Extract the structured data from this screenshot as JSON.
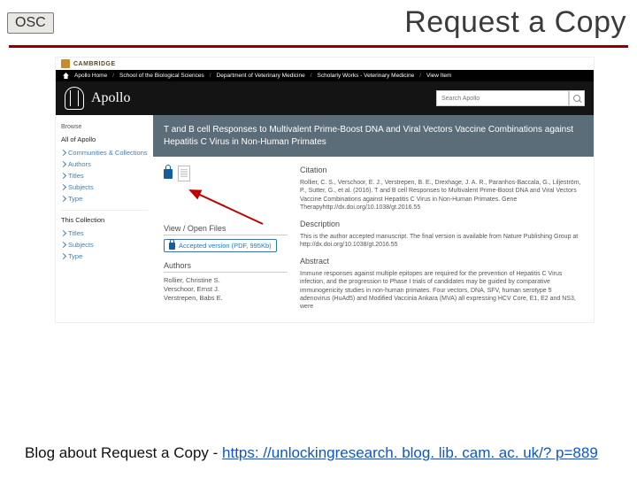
{
  "slide": {
    "badge": "OSC",
    "title": "Request a Copy",
    "caption_prefix": "Blog about Request a Copy - ",
    "caption_link": "https: //unlockingresearch. blog. lib. cam. ac. uk/? p=889"
  },
  "cambridge": {
    "name": "CAMBRIDGE"
  },
  "breadcrumbs": {
    "home": "Apollo Home",
    "b1": "School of the Biological Sciences",
    "b2": "Department of Veterinary Medicine",
    "b3": "Scholarly Works - Veterinary Medicine",
    "b4": "View Item"
  },
  "brand": "Apollo",
  "search": {
    "placeholder": "Search Apollo"
  },
  "sidebar": {
    "browse": "Browse",
    "all_heading": "All of Apollo",
    "items1": {
      "a": "Communities & Collections",
      "b": "Authors",
      "c": "Titles",
      "d": "Subjects",
      "e": "Type"
    },
    "this_heading": "This Collection",
    "items2": {
      "a": "Titles",
      "b": "Subjects",
      "c": "Type"
    }
  },
  "record": {
    "title": "T and B cell Responses to Multivalent Prime-Boost DNA and Viral Vectors Vaccine Combinations against Hepatitis C Virus in Non-Human Primates",
    "view_heading": "View / Open Files",
    "pill": "Accepted version (PDF, 995Kb)",
    "authors_heading": "Authors",
    "authors": "Rollier, Christine S.\nVerschoor, Ernst J.\nVerstrepen, Babs E.",
    "citation_heading": "Citation",
    "citation": "Rollier, C. S., Verschoor, E. J., Verstrepen, B. E., Drexhage, J. A. R., Paranhos-Baccala, G., Liljeström, P., Sutter, G., et al. (2016). T and B cell Responses to Multivalent Prime-Boost DNA and Viral Vectors Vaccine Combinations against Hepatitis C Virus in Non-Human Primates. Gene Therapyhttp://dx.doi.org/10.1038/gt.2016.55",
    "description_heading": "Description",
    "description": "This is the author accepted manuscript. The final version is available from Nature Publishing Group at http://dx.doi.org/10.1038/gt.2016.55",
    "abstract_heading": "Abstract",
    "abstract": "Immune responses against multiple epitopes are required for the prevention of Hepatitis C Virus infection, and the progression to Phase I trials of candidates may be guided by comparative immunogenicity studies in non-human primates. Four vectors, DNA, SFV, human serotype 5 adenovirus (HuAd5) and Modified Vaccinia Ankara (MVA) all expressing HCV Core, E1, E2 and NS3, were"
  }
}
